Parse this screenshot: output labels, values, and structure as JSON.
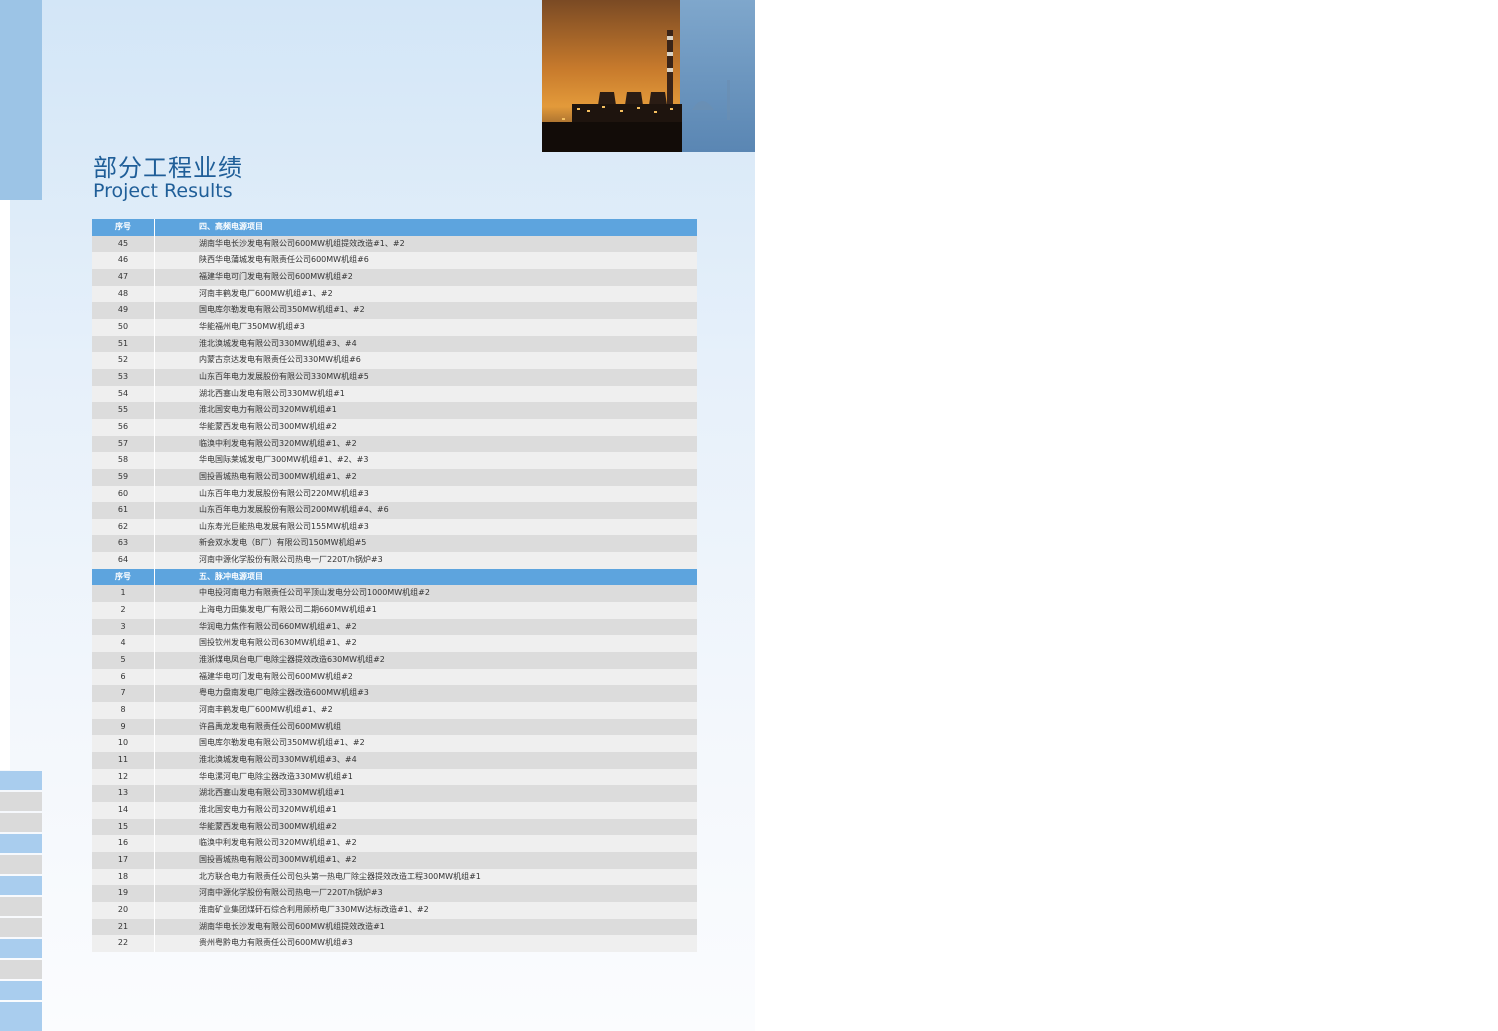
{
  "title_cn": "部分工程业绩",
  "title_en": "Project Results",
  "sections": [
    {
      "header_num": "序号",
      "header_title": "四、高频电源项目",
      "rows": [
        {
          "num": "45",
          "name": "湖南华电长沙发电有限公司600MW机组提效改造#1、#2"
        },
        {
          "num": "46",
          "name": "陕西华电蒲城发电有限责任公司600MW机组#6"
        },
        {
          "num": "47",
          "name": "福建华电可门发电有限公司600MW机组#2"
        },
        {
          "num": "48",
          "name": "河南丰鹤发电厂600MW机组#1、#2"
        },
        {
          "num": "49",
          "name": "国电库尔勒发电有限公司350MW机组#1、#2"
        },
        {
          "num": "50",
          "name": "华能福州电厂350MW机组#3"
        },
        {
          "num": "51",
          "name": "淮北涣城发电有限公司330MW机组#3、#4"
        },
        {
          "num": "52",
          "name": "内蒙古京达发电有限责任公司330MW机组#6"
        },
        {
          "num": "53",
          "name": "山东百年电力发展股份有限公司330MW机组#5"
        },
        {
          "num": "54",
          "name": "湖北西塞山发电有限公司330MW机组#1"
        },
        {
          "num": "55",
          "name": "淮北国安电力有限公司320MW机组#1"
        },
        {
          "num": "56",
          "name": "华能蒙西发电有限公司300MW机组#2"
        },
        {
          "num": "57",
          "name": "临涣中利发电有限公司320MW机组#1、#2"
        },
        {
          "num": "58",
          "name": "华电国际莱城发电厂300MW机组#1、#2、#3"
        },
        {
          "num": "59",
          "name": "国投晋城热电有限公司300MW机组#1、#2"
        },
        {
          "num": "60",
          "name": "山东百年电力发展股份有限公司220MW机组#3"
        },
        {
          "num": "61",
          "name": "山东百年电力发展股份有限公司200MW机组#4、#6"
        },
        {
          "num": "62",
          "name": "山东寿光巨能热电发展有限公司155MW机组#3"
        },
        {
          "num": "63",
          "name": "新会双水发电（B厂）有限公司150MW机组#5"
        },
        {
          "num": "64",
          "name": "河南中源化学股份有限公司热电一厂220T/h锅炉#3"
        }
      ]
    },
    {
      "header_num": "序号",
      "header_title": "五、脉冲电源项目",
      "rows": [
        {
          "num": "1",
          "name": "中电投河南电力有限责任公司平顶山发电分公司1000MW机组#2"
        },
        {
          "num": "2",
          "name": "上海电力田集发电厂有限公司二期660MW机组#1"
        },
        {
          "num": "3",
          "name": "华润电力焦作有限公司660MW机组#1、#2"
        },
        {
          "num": "4",
          "name": "国投钦州发电有限公司630MW机组#1、#2"
        },
        {
          "num": "5",
          "name": "淮浙煤电凤台电厂电除尘器提效改造630MW机组#2"
        },
        {
          "num": "6",
          "name": "福建华电可门发电有限公司600MW机组#2"
        },
        {
          "num": "7",
          "name": "粤电力盘南发电厂电除尘器改造600MW机组#3"
        },
        {
          "num": "8",
          "name": "河南丰鹤发电厂600MW机组#1、#2"
        },
        {
          "num": "9",
          "name": "许昌禹龙发电有限责任公司600MW机组"
        },
        {
          "num": "10",
          "name": "国电库尔勒发电有限公司350MW机组#1、#2"
        },
        {
          "num": "11",
          "name": "淮北涣城发电有限公司330MW机组#3、#4"
        },
        {
          "num": "12",
          "name": "华电漯河电厂电除尘器改造330MW机组#1"
        },
        {
          "num": "13",
          "name": "湖北西塞山发电有限公司330MW机组#1"
        },
        {
          "num": "14",
          "name": "淮北国安电力有限公司320MW机组#1"
        },
        {
          "num": "15",
          "name": "华能蒙西发电有限公司300MW机组#2"
        },
        {
          "num": "16",
          "name": "临涣中利发电有限公司320MW机组#1、#2"
        },
        {
          "num": "17",
          "name": "国投晋城热电有限公司300MW机组#1、#2"
        },
        {
          "num": "18",
          "name": "北方联合电力有限责任公司包头第一热电厂除尘器提效改造工程300MW机组#1"
        },
        {
          "num": "19",
          "name": "河南中源化学股份有限公司热电一厂220T/h锅炉#3"
        },
        {
          "num": "20",
          "name": "淮南矿业集团煤矸石综合利用顾桥电厂330MW达标改造#1、#2"
        },
        {
          "num": "21",
          "name": "湖南华电长沙发电有限公司600MW机组提效改造#1"
        },
        {
          "num": "22",
          "name": "贵州粤黔电力有限责任公司600MW机组#3"
        }
      ]
    }
  ],
  "colors": {
    "header_bg": "#5da4de",
    "row_odd": "#dcdcdc",
    "row_even": "#efefef",
    "title": "#1f5e98",
    "side_tab_blue": "#a9cdee",
    "side_tab_gray": "#dadada"
  }
}
